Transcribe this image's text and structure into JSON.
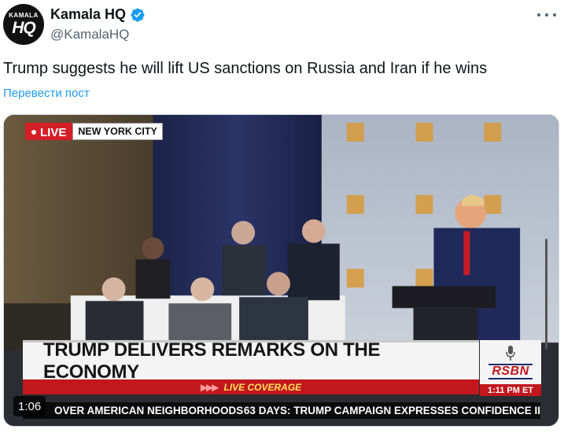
{
  "author": {
    "avatar_line1": "KAMALA",
    "avatar_line2": "HQ",
    "display_name": "Kamala HQ",
    "handle": "@KamalaHQ",
    "verified": true,
    "verified_color": "#1d9bf0"
  },
  "more_icon": "more-horizontal-icon",
  "tweet": {
    "text": "Trump suggests he will lift US sanctions on Russia and Iran if he wins",
    "translate_label": "Перевести пост"
  },
  "video": {
    "live_label": "LIVE",
    "location": "NEW YORK CITY",
    "headline": "TRUMP DELIVERS REMARKS ON THE ECONOMY",
    "coverage_label": "LIVE COVERAGE",
    "network": "RSBN",
    "clock": "1:11 PM ET",
    "ticker": [
      "OVER AMERICAN NEIGHBORHOODS",
      "63 DAYS: TRUMP CAMPAIGN EXPRESSES CONFIDENCE II"
    ],
    "duration": "1:06",
    "colors": {
      "live_red": "#d41f26",
      "banner_red": "#c2171d",
      "coverage_text": "#ffe45c"
    }
  }
}
